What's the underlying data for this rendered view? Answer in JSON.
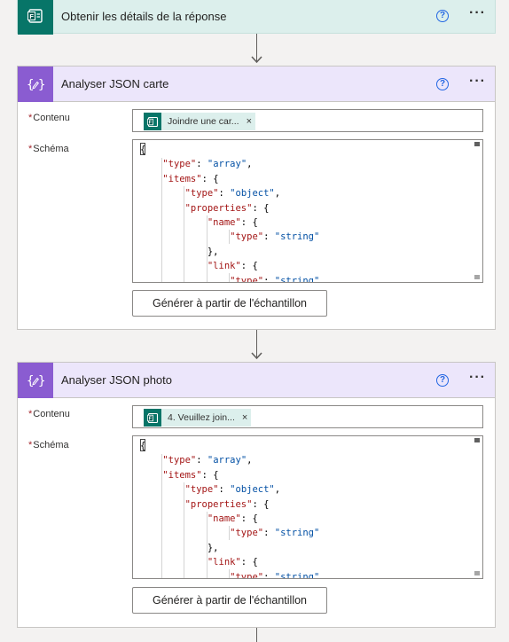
{
  "steps": {
    "get_response": {
      "title": "Obtenir les détails de la réponse",
      "icon": "microsoft-forms-icon",
      "help": "?",
      "more": "···"
    },
    "parse_card": {
      "title": "Analyser JSON carte",
      "icon": "parse-json-icon",
      "help": "?",
      "more": "···",
      "content_label": "Contenu",
      "content_token": "Joindre une car...",
      "token_close": "×",
      "schema_label": "Schéma",
      "generate_label": "Générer à partir de l'échantillon"
    },
    "parse_photo": {
      "title": "Analyser JSON photo",
      "icon": "parse-json-icon",
      "help": "?",
      "more": "···",
      "content_label": "Contenu",
      "content_token": "4. Veuillez join...",
      "token_close": "×",
      "schema_label": "Schéma",
      "generate_label": "Générer à partir de l'échantillon"
    }
  },
  "required_marker": "*",
  "schema_code": {
    "l1": "{",
    "l2a": "\"type\"",
    "l2b": ": ",
    "l2c": "\"array\"",
    "l2d": ",",
    "l3a": "\"items\"",
    "l3b": ": {",
    "l4a": "\"type\"",
    "l4b": ": ",
    "l4c": "\"object\"",
    "l4d": ",",
    "l5a": "\"properties\"",
    "l5b": ": {",
    "l6a": "\"name\"",
    "l6b": ": {",
    "l7a": "\"type\"",
    "l7b": ": ",
    "l7c": "\"string\"",
    "l8": "},",
    "l9a": "\"link\"",
    "l9b": ": {",
    "l10a": "\"type\"",
    "l10b": ": ",
    "l10c": "\"string\""
  }
}
